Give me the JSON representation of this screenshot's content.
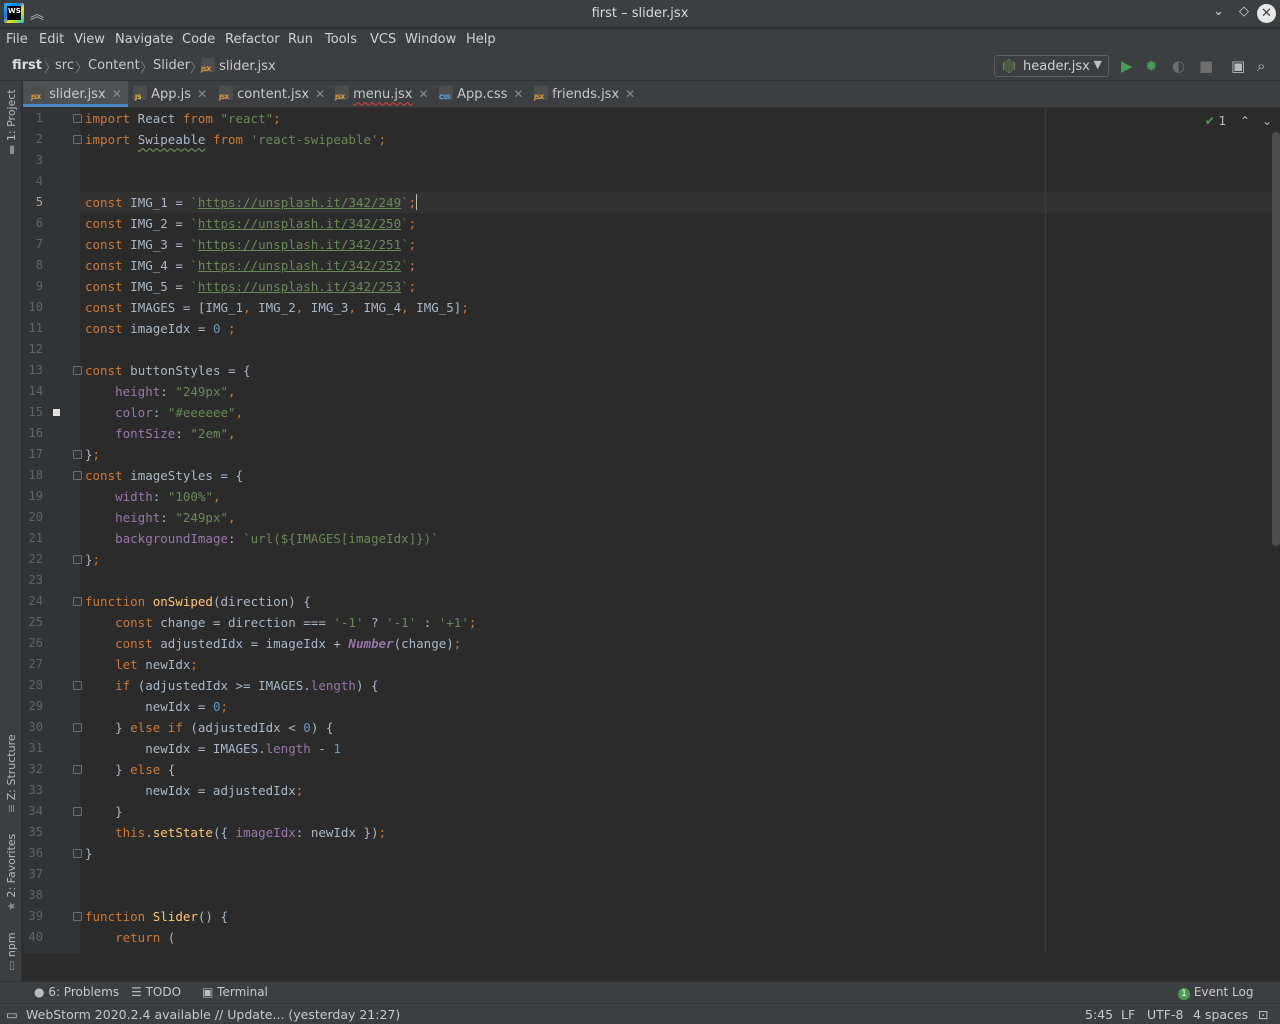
{
  "window": {
    "title": "first – slider.jsx"
  },
  "menu": [
    "File",
    "Edit",
    "View",
    "Navigate",
    "Code",
    "Refactor",
    "Run",
    "Tools",
    "VCS",
    "Window",
    "Help"
  ],
  "breadcrumb": {
    "project": "first",
    "items": [
      "src",
      "Content",
      "Slider",
      "slider.jsx"
    ]
  },
  "run_config": {
    "label": "header.jsx"
  },
  "left_tools": {
    "project": "1: Project",
    "structure": "Z: Structure",
    "favorites": "2: Favorites",
    "npm": "npm"
  },
  "tabs": [
    {
      "label": "slider.jsx",
      "icon": "jsx-file-icon",
      "active": true
    },
    {
      "label": "App.js",
      "icon": "js-file-icon",
      "active": false
    },
    {
      "label": "content.jsx",
      "icon": "jsx-file-icon",
      "active": false
    },
    {
      "label": "menu.jsx",
      "icon": "jsx-file-icon",
      "active": false
    },
    {
      "label": "App.css",
      "icon": "css-file-icon",
      "active": false
    },
    {
      "label": "friends.jsx",
      "icon": "jsx-file-icon",
      "active": false
    }
  ],
  "editor": {
    "inspection_count": "1",
    "current_line": 5,
    "line_numbers": [
      "1",
      "2",
      "3",
      "4",
      "5",
      "6",
      "7",
      "8",
      "9",
      "10",
      "11",
      "12",
      "13",
      "14",
      "15",
      "16",
      "17",
      "18",
      "19",
      "20",
      "21",
      "22",
      "23",
      "24",
      "25",
      "26",
      "27",
      "28",
      "29",
      "30",
      "31",
      "32",
      "33",
      "34",
      "35",
      "36",
      "37",
      "38",
      "39",
      "40"
    ],
    "code_lines": [
      "import React from \"react\";",
      "import Swipeable from 'react-swipeable';",
      "",
      "",
      "const IMG_1 = `https://unsplash.it/342/249`;",
      "const IMG_2 = `https://unsplash.it/342/250`;",
      "const IMG_3 = `https://unsplash.it/342/251`;",
      "const IMG_4 = `https://unsplash.it/342/252`;",
      "const IMG_5 = `https://unsplash.it/342/253`;",
      "const IMAGES = [IMG_1, IMG_2, IMG_3, IMG_4, IMG_5];",
      "const imageIdx = 0 ;",
      "",
      "const buttonStyles = {",
      "    height: \"249px\",",
      "    color: \"#eeeeee\",",
      "    fontSize: \"2em\",",
      "};",
      "const imageStyles = {",
      "    width: \"100%\",",
      "    height: \"249px\",",
      "    backgroundImage: `url(${IMAGES[imageIdx]})`",
      "};",
      "",
      "function onSwiped(direction) {",
      "    const change = direction === '-1' ? '-1' : '+1';",
      "    const adjustedIdx = imageIdx + Number(change);",
      "    let newIdx;",
      "    if (adjustedIdx >= IMAGES.length) {",
      "        newIdx = 0;",
      "    } else if (adjustedIdx < 0) {",
      "        newIdx = IMAGES.length - 1",
      "    } else {",
      "        newIdx = adjustedIdx;",
      "    }",
      "    this.setState({ imageIdx: newIdx });",
      "}",
      "",
      "",
      "function Slider() {",
      "    return ("
    ]
  },
  "bottom_tools": {
    "problems": "6: Problems",
    "todo": "TODO",
    "terminal": "Terminal",
    "event_log": "Event Log",
    "event_count": "1"
  },
  "status": {
    "message": "WebStorm 2020.2.4 available // Update... (yesterday 21:27)",
    "position": "5:45",
    "line_sep": "LF",
    "encoding": "UTF-8",
    "indent": "4 spaces"
  },
  "colors": {
    "background": "#2b2b2b",
    "chrome": "#3c3f41",
    "keyword": "#cc7832",
    "string": "#6a8759",
    "number": "#6897bb",
    "property": "#9876aa",
    "function": "#ffc66d",
    "accent": "#4a88c7"
  }
}
